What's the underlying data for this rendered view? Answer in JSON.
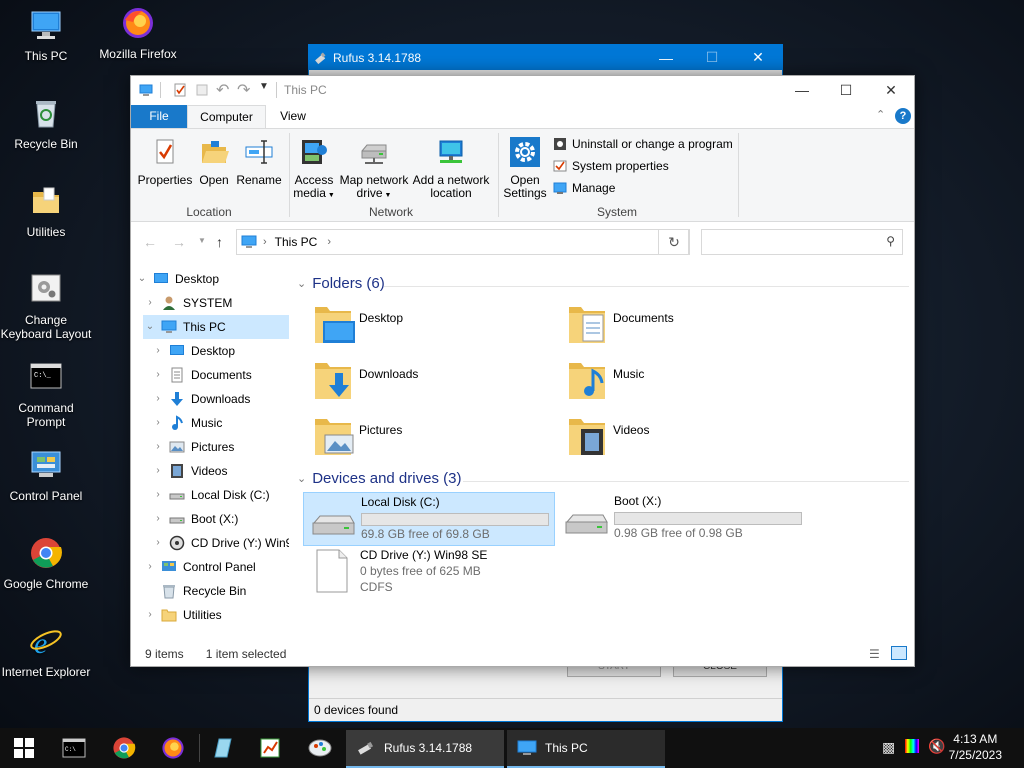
{
  "desktop": {
    "icons": [
      {
        "label": "This PC",
        "icon": "computer-icon"
      },
      {
        "label": "Mozilla Firefox",
        "icon": "firefox-icon"
      },
      {
        "label": "Recycle Bin",
        "icon": "recycle-bin-icon"
      },
      {
        "label": "Utilities",
        "icon": "folder-icon"
      },
      {
        "label": "Change Keyboard Layout",
        "icon": "keyboard-settings-icon"
      },
      {
        "label": "Command Prompt",
        "icon": "command-prompt-icon"
      },
      {
        "label": "Control Panel",
        "icon": "control-panel-icon"
      },
      {
        "label": "Google Chrome",
        "icon": "chrome-icon"
      },
      {
        "label": "Internet Explorer",
        "icon": "internet-explorer-icon"
      }
    ]
  },
  "rufus": {
    "title": "Rufus 3.14.1788",
    "start_label": "START",
    "close_label": "CLOSE",
    "status": "0 devices found"
  },
  "explorer": {
    "title": "This PC",
    "tabs": {
      "file": "File",
      "computer": "Computer",
      "view": "View"
    },
    "ribbon": {
      "properties": "Properties",
      "open": "Open",
      "rename": "Rename",
      "location_group": "Location",
      "access_media_1": "Access",
      "access_media_2": "media",
      "map_drive_1": "Map network",
      "map_drive_2": "drive",
      "add_location_1": "Add a network",
      "add_location_2": "location",
      "network_group": "Network",
      "open_settings_1": "Open",
      "open_settings_2": "Settings",
      "uninstall": "Uninstall or change a program",
      "system_properties": "System properties",
      "manage": "Manage",
      "system_group": "System"
    },
    "address": {
      "path": "This PC",
      "search_placeholder": ""
    },
    "nav_tree": [
      {
        "label": "Desktop",
        "icon": "desktop-icon"
      },
      {
        "label": "SYSTEM",
        "icon": "user-icon"
      },
      {
        "label": "This PC",
        "icon": "computer-icon"
      },
      {
        "label": "Desktop",
        "icon": "desktop-icon"
      },
      {
        "label": "Documents",
        "icon": "documents-icon"
      },
      {
        "label": "Downloads",
        "icon": "downloads-icon"
      },
      {
        "label": "Music",
        "icon": "music-icon"
      },
      {
        "label": "Pictures",
        "icon": "pictures-icon"
      },
      {
        "label": "Videos",
        "icon": "videos-icon"
      },
      {
        "label": "Local Disk (C:)",
        "icon": "drive-icon"
      },
      {
        "label": "Boot (X:)",
        "icon": "drive-icon"
      },
      {
        "label": "CD Drive (Y:) Win98 SE",
        "icon": "cd-drive-icon"
      },
      {
        "label": "Control Panel",
        "icon": "control-panel-icon"
      },
      {
        "label": "Recycle Bin",
        "icon": "recycle-bin-icon"
      },
      {
        "label": "Utilities",
        "icon": "folder-icon"
      }
    ],
    "folders_header": "Folders (6)",
    "folders": [
      {
        "name": "Desktop",
        "icon": "desktop-folder-icon"
      },
      {
        "name": "Documents",
        "icon": "documents-folder-icon"
      },
      {
        "name": "Downloads",
        "icon": "downloads-folder-icon"
      },
      {
        "name": "Music",
        "icon": "music-folder-icon"
      },
      {
        "name": "Pictures",
        "icon": "pictures-folder-icon"
      },
      {
        "name": "Videos",
        "icon": "videos-folder-icon"
      }
    ],
    "drives_header": "Devices and drives (3)",
    "drives": [
      {
        "name": "Local Disk (C:)",
        "free": "69.8 GB free of 69.8 GB",
        "used_fraction": 0.0
      },
      {
        "name": "Boot (X:)",
        "free": "0.98 GB free of 0.98 GB",
        "used_fraction": 0.0
      },
      {
        "name": "CD Drive (Y:) Win98 SE",
        "free": "0 bytes free of 625 MB",
        "fs": "CDFS"
      }
    ],
    "status": {
      "items": "9 items",
      "selected": "1 item selected"
    }
  },
  "taskbar": {
    "tasks": [
      {
        "label": "Rufus 3.14.1788"
      },
      {
        "label": "This PC"
      }
    ],
    "time": "4:13 AM",
    "date": "7/25/2023"
  }
}
